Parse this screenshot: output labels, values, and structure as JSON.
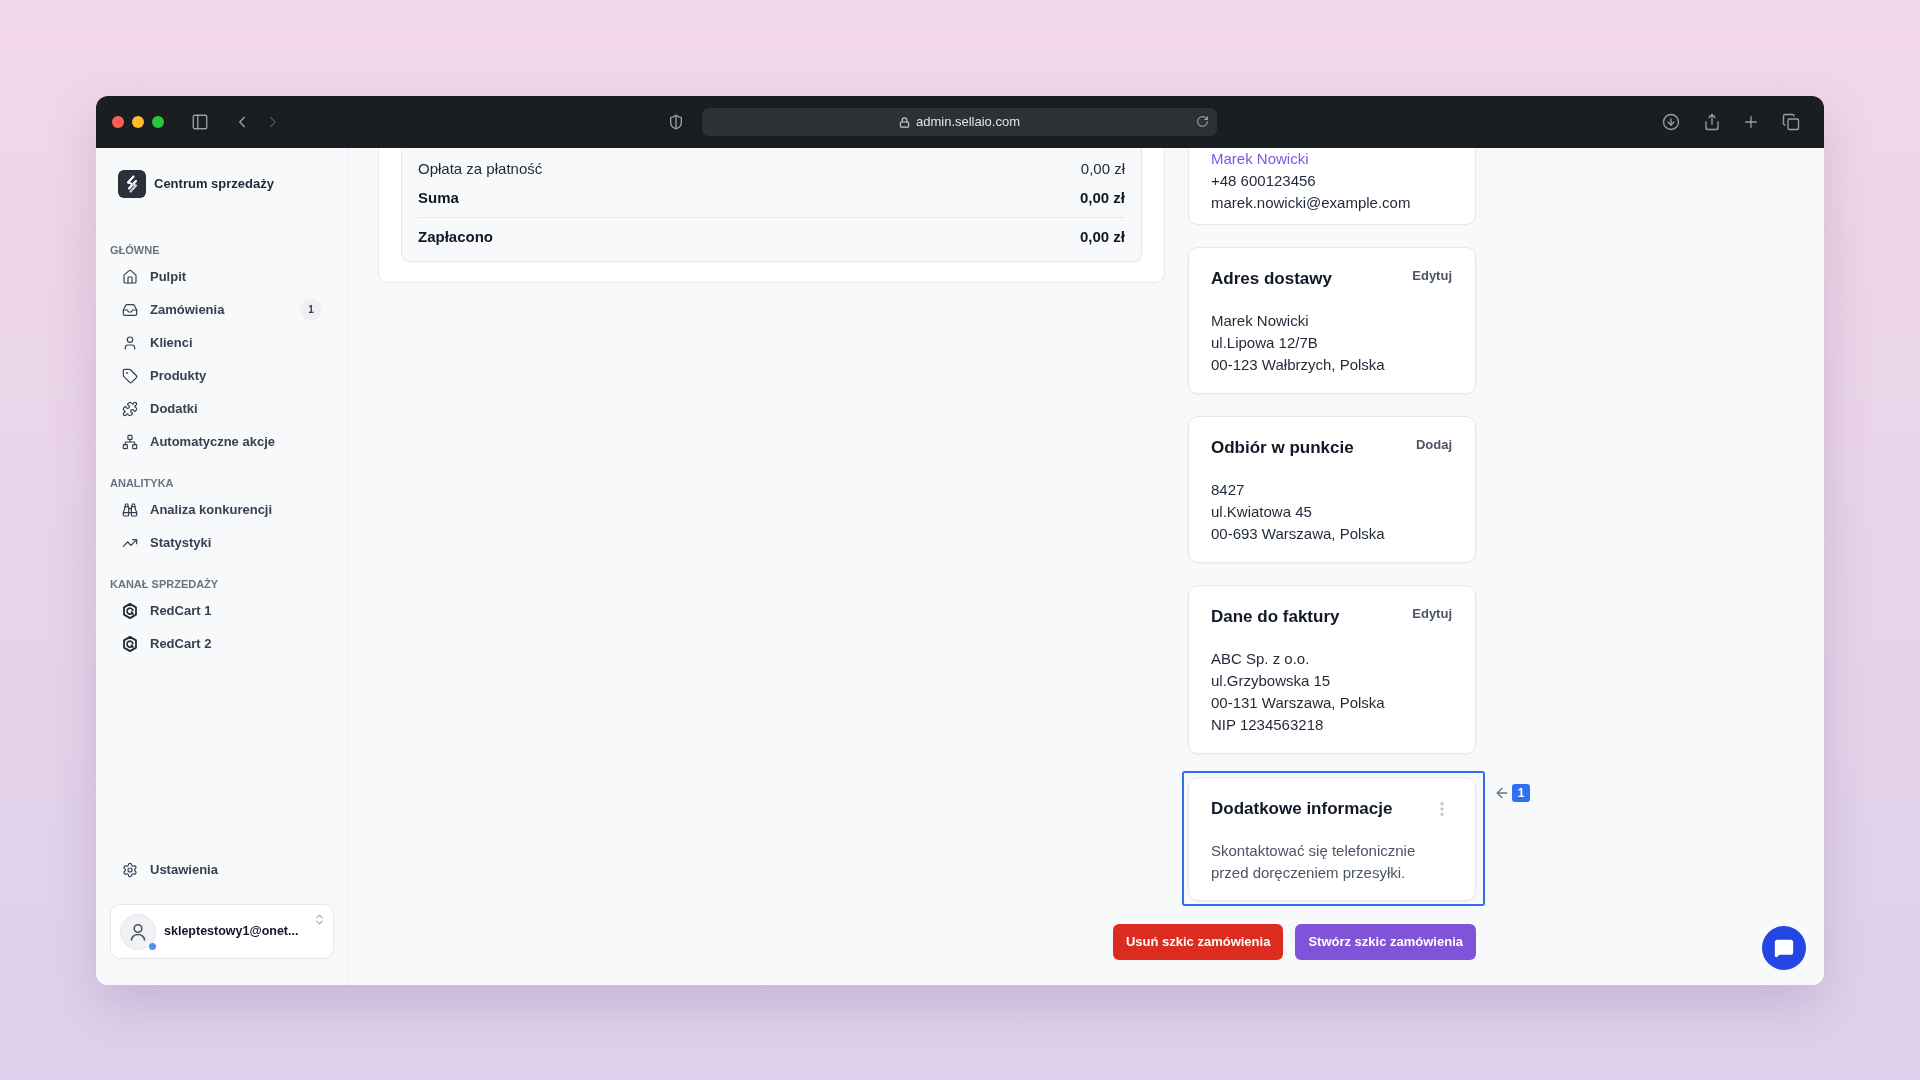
{
  "browser": {
    "url": "admin.sellaio.com",
    "back_enabled": true,
    "forward_enabled": false
  },
  "sidebar": {
    "brand": "Centrum sprzedaży",
    "sections": [
      {
        "label": "GŁÓWNE",
        "items": [
          {
            "label": "Pulpit",
            "selected": false
          },
          {
            "label": "Zamówienia",
            "selected": false,
            "badge": "1"
          },
          {
            "label": "Klienci",
            "selected": false
          },
          {
            "label": "Produkty",
            "selected": false
          },
          {
            "label": "Dodatki",
            "selected": false
          },
          {
            "label": "Automatyczne akcje",
            "selected": false
          }
        ]
      },
      {
        "label": "ANALITYKA",
        "items": [
          {
            "label": "Analiza konkurencji",
            "selected": false
          },
          {
            "label": "Statystyki",
            "selected": false
          }
        ]
      },
      {
        "label": "KANAŁ SPRZEDAŻY",
        "items": [
          {
            "label": "RedCart 1",
            "selected": false
          },
          {
            "label": "RedCart 2",
            "selected": false
          }
        ]
      }
    ],
    "settings": {
      "label": "Ustawienia",
      "selected": false
    },
    "user": {
      "email": "skleptestowy1@onet...",
      "online": true
    }
  },
  "summary": {
    "rows": [
      {
        "kind": "line",
        "label": "Opłata za płatność",
        "value": "0,00 zł"
      },
      {
        "kind": "total",
        "label": "Suma",
        "value": "0,00 zł"
      },
      {
        "kind": "paid",
        "label": "Zapłacono",
        "value": "0,00 zł"
      }
    ]
  },
  "customer": {
    "name": "Marek Nowicki",
    "phone": "+48 600123456",
    "email": "marek.nowicki@example.com"
  },
  "cards": [
    {
      "title": "Adres dostawy",
      "action": "Edytuj",
      "lines": [
        "Marek Nowicki",
        "ul.Lipowa 12/7B",
        "00-123 Wałbrzych, Polska"
      ]
    },
    {
      "title": "Odbiór w punkcie",
      "action": "Dodaj",
      "lines": [
        "8427",
        "ul.Kwiatowa 45",
        "00-693 Warszawa, Polska"
      ]
    },
    {
      "title": "Dane do faktury",
      "action": "Edytuj",
      "lines": [
        "ABC Sp. z o.o.",
        "ul.Grzybowska 15",
        "00-131 Warszawa, Polska",
        "NIP 1234563218"
      ]
    }
  ],
  "notes": {
    "title": "Dodatkowe informacje",
    "text": "Skontaktować się telefonicznie przed doręczeniem przesyłki.",
    "highlighted": true,
    "step": "1"
  },
  "buttons": [
    {
      "kind": "danger",
      "label": "Usuń szkic zamówienia"
    },
    {
      "kind": "primary",
      "label": "Stwórz szkic zamówienia"
    }
  ]
}
